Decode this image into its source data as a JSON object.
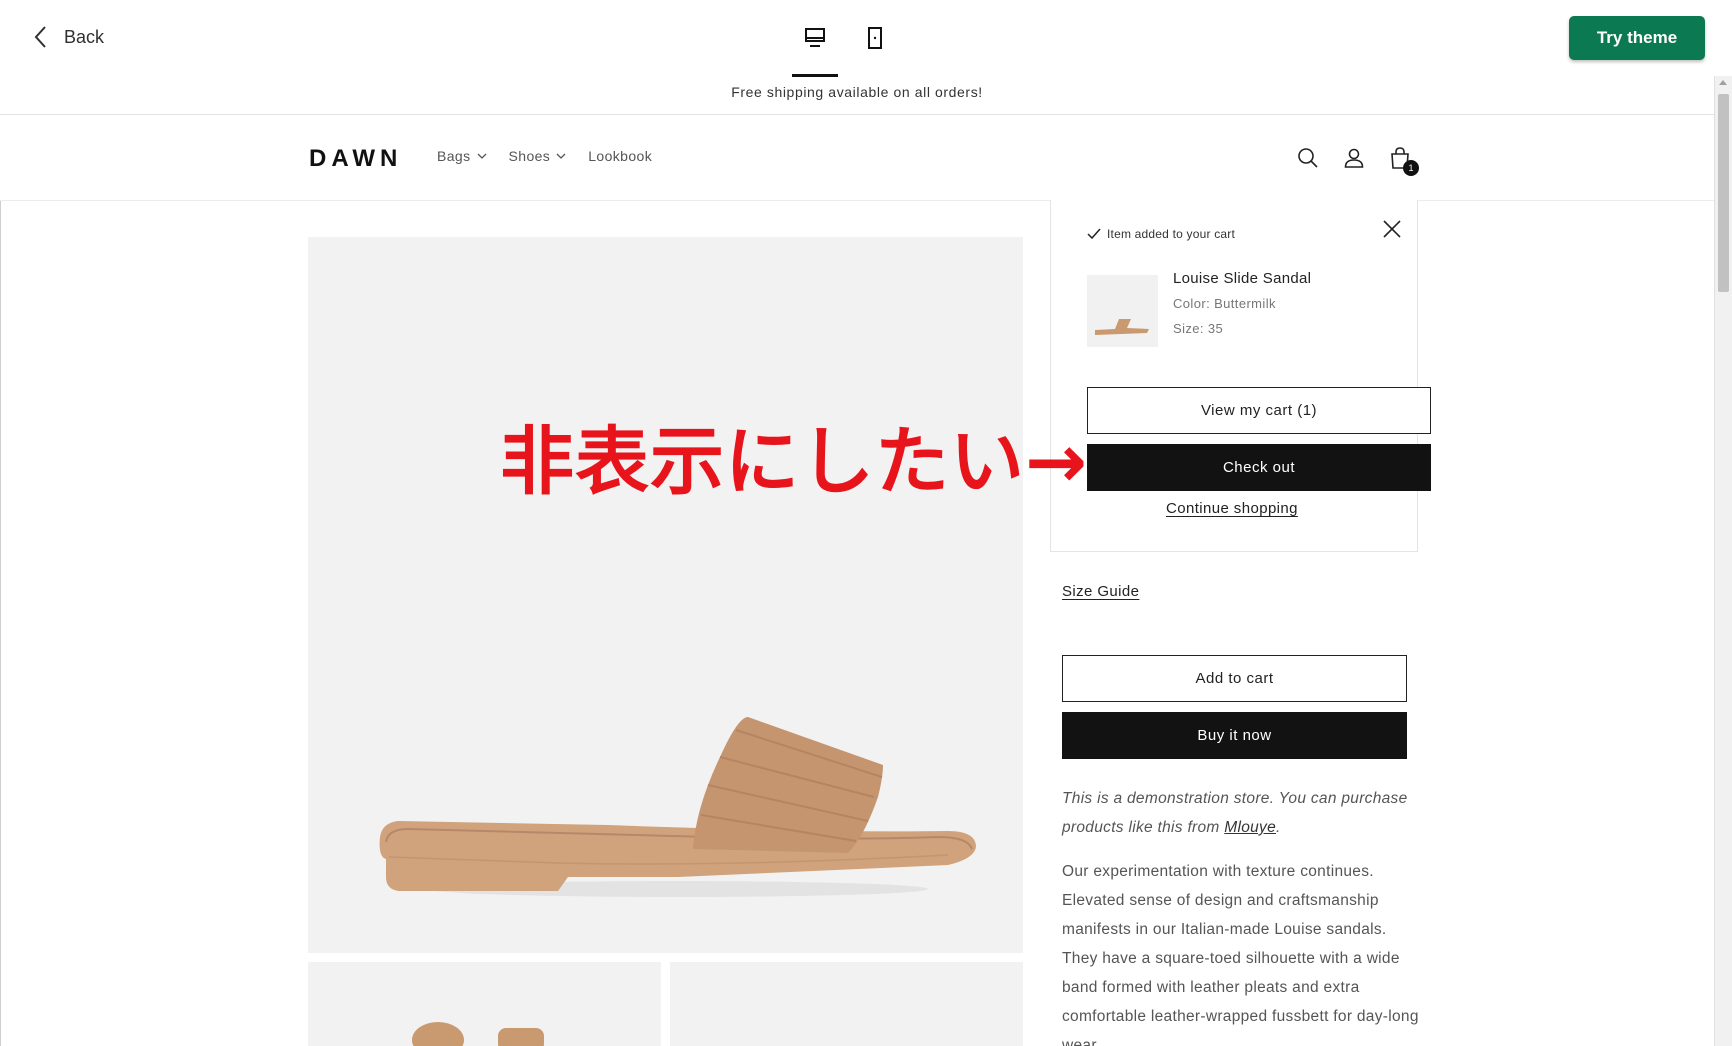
{
  "editor": {
    "back_label": "Back",
    "try_theme_label": "Try theme",
    "devices": [
      "desktop-icon",
      "mobile-icon"
    ]
  },
  "store": {
    "announcement": "Free shipping available on all orders!",
    "logo": "DAWN",
    "nav": [
      {
        "label": "Bags",
        "dropdown": true
      },
      {
        "label": "Shoes",
        "dropdown": true
      },
      {
        "label": "Lookbook",
        "dropdown": false
      }
    ],
    "cart_count": "1"
  },
  "cart_popup": {
    "added_text": "Item added to your cart",
    "product_name": "Louise Slide Sandal",
    "color": "Color: Buttermilk",
    "size": "Size: 35",
    "view_cart": "View my cart (1)",
    "checkout": "Check out",
    "continue": "Continue shopping"
  },
  "product": {
    "size_guide": "Size Guide",
    "add_to_cart": "Add to cart",
    "buy_now": "Buy it now",
    "demo_text": "This is a demonstration store. You can purchase products like this from",
    "demo_link": "Mlouye",
    "description": "Our experimentation with texture continues. Elevated sense of design and craftsmanship manifests in our Italian-made Louise sandals. They have a square-toed silhouette with a wide band formed with leather pleats and extra comfortable leather-wrapped fussbett for day-long wear."
  },
  "annotation": {
    "text": "非表示にしたい→"
  },
  "colors": {
    "accent": "#0b7a52",
    "annotation": "#e8141c",
    "sandal": "#d2a67f"
  }
}
